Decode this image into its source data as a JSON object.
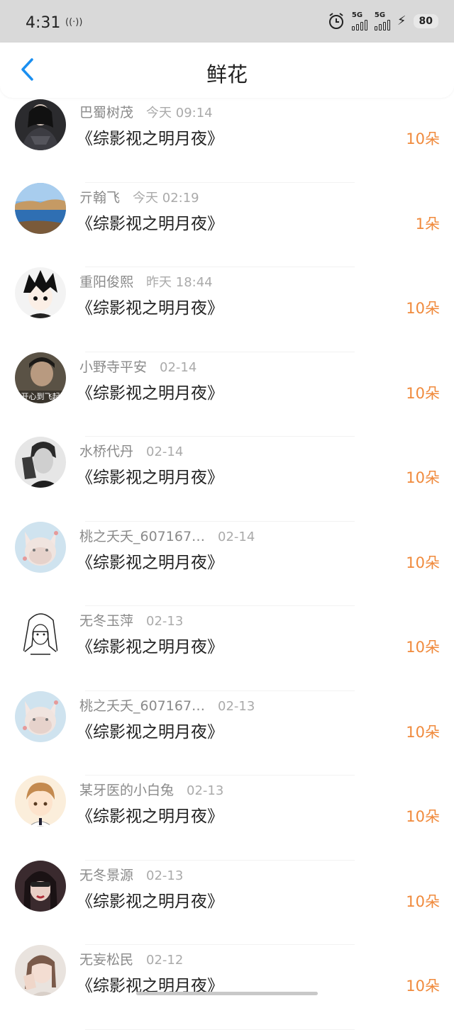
{
  "status_bar": {
    "time": "4:31",
    "hotspot": "((·))",
    "signal1_label": "5G",
    "signal2_label": "5G",
    "battery": "80"
  },
  "header": {
    "title": "鲜花",
    "back_icon": "chevron-left-icon"
  },
  "colors": {
    "accent": "#1a8ff0",
    "count": "#f08a3c",
    "name": "#8a8a8a",
    "time": "#aaaaaa"
  },
  "records": [
    {
      "name": "巴蜀树茂",
      "time": "今天 09:14",
      "book": "《综影视之明月夜》",
      "count": "10朵",
      "avatar": "dark-armor"
    },
    {
      "name": "亓翰飞",
      "time": "今天 02:19",
      "book": "《综影视之明月夜》",
      "count": "1朵",
      "avatar": "lake"
    },
    {
      "name": "重阳俊熙",
      "time": "昨天 18:44",
      "book": "《综影视之明月夜》",
      "count": "10朵",
      "avatar": "anime-boy"
    },
    {
      "name": "小野寺平安",
      "time": "02-14",
      "book": "《综影视之明月夜》",
      "count": "10朵",
      "avatar": "photo-man"
    },
    {
      "name": "水桥代丹",
      "time": "02-14",
      "book": "《综影视之明月夜》",
      "count": "10朵",
      "avatar": "bw-man"
    },
    {
      "name": "桃之夭夭_607167…",
      "time": "02-14",
      "book": "《综影视之明月夜》",
      "count": "10朵",
      "avatar": "cat"
    },
    {
      "name": "无冬玉萍",
      "time": "02-13",
      "book": "《综影视之明月夜》",
      "count": "10朵",
      "avatar": "sketch-girl"
    },
    {
      "name": "桃之夭夭_607167…",
      "time": "02-13",
      "book": "《综影视之明月夜》",
      "count": "10朵",
      "avatar": "cat"
    },
    {
      "name": "某牙医的小白兔",
      "time": "02-13",
      "book": "《综影视之明月夜》",
      "count": "10朵",
      "avatar": "cartoon-boy"
    },
    {
      "name": "无冬景源",
      "time": "02-13",
      "book": "《综影视之明月夜》",
      "count": "10朵",
      "avatar": "woman-dark"
    },
    {
      "name": "无妄松民",
      "time": "02-12",
      "book": "《综影视之明月夜》",
      "count": "10朵",
      "avatar": "woman-light"
    }
  ]
}
